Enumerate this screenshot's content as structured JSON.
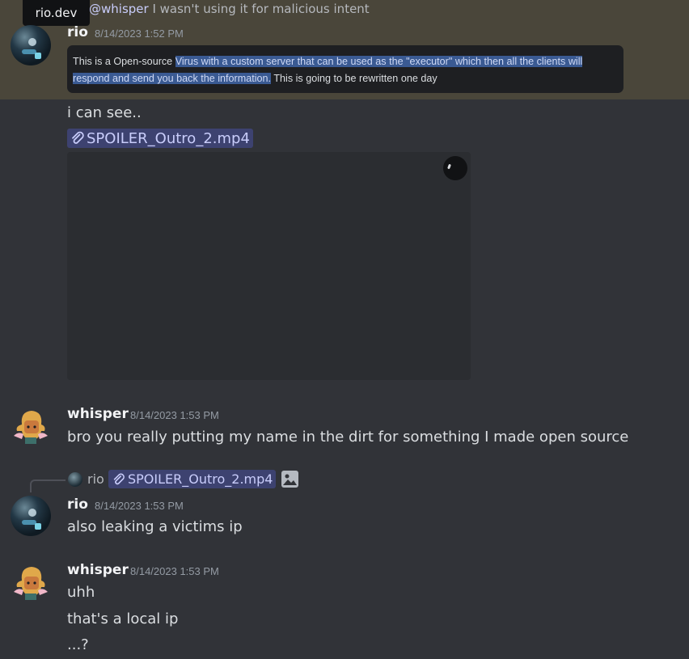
{
  "tooltip": {
    "text": "rio.dev"
  },
  "reply_header": {
    "mention": "@whisper",
    "text": " I wasn't using it for malicious intent"
  },
  "messages": [
    {
      "author": "rio",
      "timestamp": "8/14/2023 1:52 PM",
      "code_plain_before": "This is a Open-source ",
      "code_selected": "Virus with a custom server that can be used as the \"executor\" which then all the clients will respond and send you back the information.",
      "code_plain_after": " This is going to be rewritten one day",
      "text": "i can see..",
      "attachment": "SPOILER_Outro_2.mp4"
    },
    {
      "author": "whisper",
      "timestamp": "8/14/2023 1:53 PM",
      "text": "bro you really putting my name in the dirt for something I made open source"
    },
    {
      "reply_to": {
        "author": "rio",
        "attachment": "SPOILER_Outro_2.mp4"
      },
      "author": "rio",
      "timestamp": "8/14/2023 1:53 PM",
      "text": "also leaking a victims ip"
    },
    {
      "author": "whisper",
      "timestamp": "8/14/2023 1:53 PM",
      "lines": [
        "uhh",
        "that's a local ip",
        "...?"
      ]
    }
  ]
}
